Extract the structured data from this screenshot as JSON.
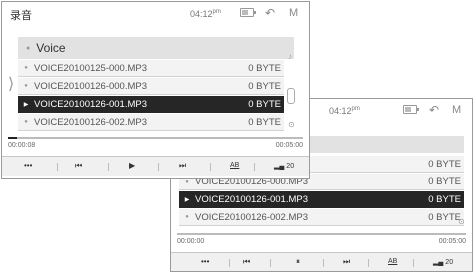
{
  "front": {
    "app_title": "录音",
    "clock": "04:12",
    "clock_suffix": "pm",
    "folder": "Voice",
    "files": [
      {
        "name": "VOICE20100125-000.MP3",
        "size": "0 BYTE",
        "selected": false
      },
      {
        "name": "VOICE20100126-000.MP3",
        "size": "0 BYTE",
        "selected": false
      },
      {
        "name": "VOICE20100126-001.MP3",
        "size": "0 BYTE",
        "selected": true
      },
      {
        "name": "VOICE20100126-002.MP3",
        "size": "0 BYTE",
        "selected": false
      }
    ],
    "elapsed": "00:00:08",
    "total": "00:05:00",
    "progress_fraction": 0.03,
    "controls": {
      "more": "•••",
      "prev": "⏮",
      "play": "▶",
      "next": "⏭",
      "ab": "AB",
      "volume": "20"
    }
  },
  "back": {
    "clock": "04:12",
    "clock_suffix": "pm",
    "files": [
      {
        "name": "VOICE20100126-000.MP3",
        "size": "0 BYTE",
        "selected": false
      },
      {
        "name": "VOICE20100126-001.MP3",
        "size": "0 BYTE",
        "selected": true
      },
      {
        "name": "VOICE20100126-002.MP3",
        "size": "0 BYTE",
        "selected": false
      }
    ],
    "extra_size": "0 BYTE",
    "elapsed": "00:00:00",
    "total": "00:05:00",
    "progress_fraction": 0.0,
    "controls": {
      "more": "•••",
      "prev": "⏮",
      "pause": "⏸",
      "next": "⏭",
      "ab": "AB",
      "volume": "20"
    }
  },
  "icons": {
    "back": "↶",
    "menu": "M"
  }
}
